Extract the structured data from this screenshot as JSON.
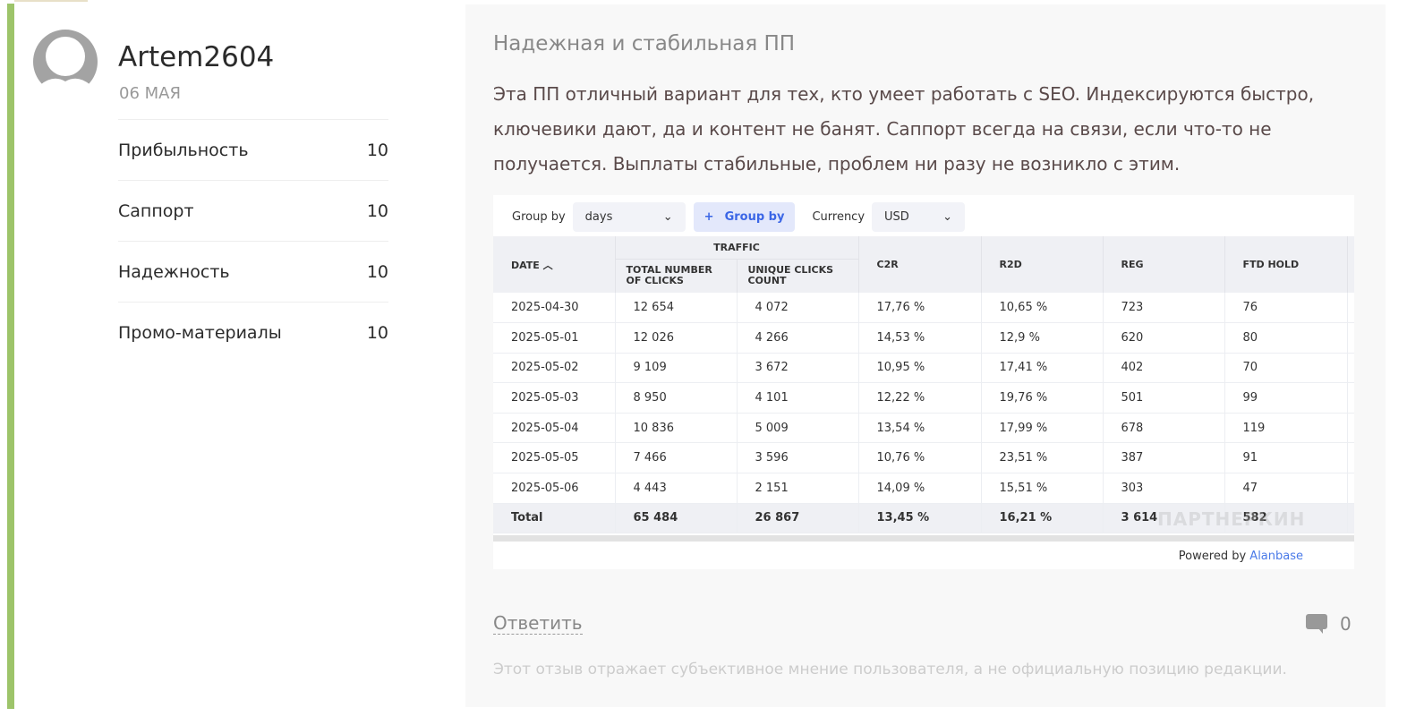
{
  "author": {
    "name": "Artem2604",
    "date": "06 МАЯ"
  },
  "ratings": [
    {
      "label": "Прибыльность",
      "value": "10"
    },
    {
      "label": "Саппорт",
      "value": "10"
    },
    {
      "label": "Надежность",
      "value": "10"
    },
    {
      "label": "Промо-материалы",
      "value": "10"
    }
  ],
  "review": {
    "title": "Надежная и стабильная ПП",
    "text": "Эта ПП отличный вариант для тех, кто умеет работать с SEO. Индексируются быстро, ключевики дают, да и контент не банят. Саппорт всегда на связи, если что-то не получается. Выплаты стабильные, проблем ни разу не возникло с этим."
  },
  "stats": {
    "group_by_label": "Group by",
    "group_by_value": "days",
    "add_group_label": "Group by",
    "currency_label": "Currency",
    "currency_value": "USD",
    "headers": {
      "date": "DATE",
      "traffic": "TRAFFIC",
      "total_clicks": "TOTAL NUMBER OF CLICKS",
      "unique_clicks": "UNIQUE CLICKS COUNT",
      "c2r": "C2R",
      "r2d": "R2D",
      "reg": "REG",
      "ftd_hold": "FTD HOLD"
    },
    "rows": [
      [
        "2025-04-30",
        "12 654",
        "4 072",
        "17,76 %",
        "10,65 %",
        "723",
        "76"
      ],
      [
        "2025-05-01",
        "12 026",
        "4 266",
        "14,53 %",
        "12,9 %",
        "620",
        "80"
      ],
      [
        "2025-05-02",
        "9 109",
        "3 672",
        "10,95 %",
        "17,41 %",
        "402",
        "70"
      ],
      [
        "2025-05-03",
        "8 950",
        "4 101",
        "12,22 %",
        "19,76 %",
        "501",
        "99"
      ],
      [
        "2025-05-04",
        "10 836",
        "5 009",
        "13,54 %",
        "17,99 %",
        "678",
        "119"
      ],
      [
        "2025-05-05",
        "7 466",
        "3 596",
        "10,76 %",
        "23,51 %",
        "387",
        "91"
      ],
      [
        "2025-05-06",
        "4 443",
        "2 151",
        "14,09 %",
        "15,51 %",
        "303",
        "47"
      ]
    ],
    "total": [
      "Total",
      "65 484",
      "26 867",
      "13,45 %",
      "16,21 %",
      "3 614",
      "582"
    ],
    "powered_by": "Powered by",
    "powered_link": "Alanbase",
    "watermark": "ПАРТНЕРКИН"
  },
  "actions": {
    "reply": "Ответить",
    "comment_count": "0"
  },
  "disclaimer": "Этот отзыв отражает субъективное мнение пользователя, а не официальную позицию редакции.",
  "colors": {
    "accent_bar": "#9dc46a",
    "link": "#4a7ae8"
  }
}
